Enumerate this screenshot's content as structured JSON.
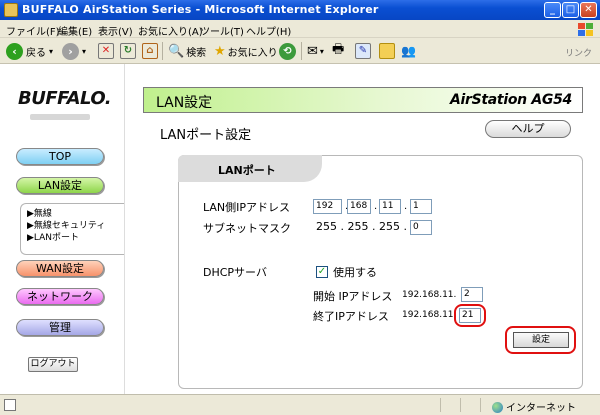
{
  "window": {
    "title": "BUFFALO AirStation Series - Microsoft Internet Explorer"
  },
  "menu": [
    "ファイル(F)",
    "編集(E)",
    "表示(V)",
    "お気に入り(A)",
    "ツール(T)",
    "ヘルプ(H)"
  ],
  "toolbar": {
    "back": "戻る",
    "search": "検索",
    "favorites": "お気に入り",
    "links": "リンク"
  },
  "nav": {
    "logo": "BUFFALO.",
    "top": "TOP",
    "lan": "LAN設定",
    "sub_items": [
      "▶無線",
      "▶無線セキュリティ",
      "▶LANポート"
    ],
    "wan": "WAN設定",
    "network": "ネットワーク",
    "admin": "管理",
    "logout": "ログアウト"
  },
  "header": {
    "title": "LAN設定",
    "brand": "AirStation AG54"
  },
  "page": {
    "title": "LANポート設定",
    "help": "ヘルプ",
    "tab": "LANポート"
  },
  "form": {
    "lan_ip_label": "LAN側IPアドレス",
    "lan_ip": [
      "192",
      "168",
      "11",
      "1"
    ],
    "subnet_label": "サブネットマスク",
    "subnet_fixed": "255 . 255 . 255 .",
    "subnet_last": "0",
    "dhcp_label": "DHCPサーバ",
    "dhcp_use": "使用する",
    "dhcp_checked": true,
    "start_label": "開始 IPアドレス",
    "start_prefix": "192.168.11.",
    "start_value": "2",
    "end_label": "終了IPアドレス",
    "end_prefix": "192.168.11",
    "end_value": "21",
    "submit": "設定"
  },
  "status": {
    "zone": "インターネット"
  }
}
